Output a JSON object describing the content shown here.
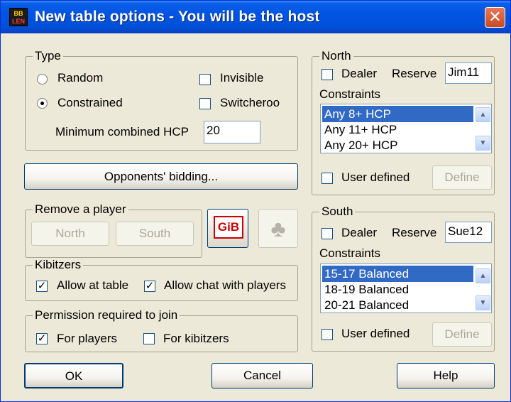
{
  "window": {
    "title": "New table options - You will be the host",
    "icon_text_top": "BB",
    "icon_text_bottom": "LEN"
  },
  "type_group": {
    "legend": "Type",
    "random_label": "Random",
    "constrained_label": "Constrained",
    "selected": "Constrained",
    "invisible_label": "Invisible",
    "invisible_checked": false,
    "switcheroo_label": "Switcheroo",
    "switcheroo_checked": false,
    "min_hcp_label": "Minimum combined HCP",
    "min_hcp_value": "20"
  },
  "opponents_bidding_button": "Opponents' bidding...",
  "remove_player": {
    "legend": "Remove a player",
    "north_button": "North",
    "south_button": "South"
  },
  "gib_button": "GiB",
  "kibitzers": {
    "legend": "Kibitzers",
    "allow_at_table_label": "Allow at table",
    "allow_at_table_checked": true,
    "allow_chat_label": "Allow chat with players",
    "allow_chat_checked": true
  },
  "permission": {
    "legend": "Permission required to join",
    "players_label": "For players",
    "players_checked": true,
    "kibitzers_label": "For kibitzers",
    "kibitzers_checked": false
  },
  "north": {
    "legend": "North",
    "dealer_label": "Dealer",
    "dealer_checked": false,
    "reserve_label": "Reserve",
    "reserve_value": "Jim11",
    "constraints_label": "Constraints",
    "items": [
      "Any 8+ HCP",
      "Any 11+ HCP",
      "Any 20+ HCP"
    ],
    "selected_index": 0,
    "user_defined_label": "User defined",
    "user_defined_checked": false,
    "define_button": "Define"
  },
  "south": {
    "legend": "South",
    "dealer_label": "Dealer",
    "dealer_checked": false,
    "reserve_label": "Reserve",
    "reserve_value": "Sue12",
    "constraints_label": "Constraints",
    "items": [
      "15-17 Balanced",
      "18-19 Balanced",
      "20-21 Balanced"
    ],
    "selected_index": 0,
    "user_defined_label": "User defined",
    "user_defined_checked": false,
    "define_button": "Define"
  },
  "buttons": {
    "ok": "OK",
    "cancel": "Cancel",
    "help": "Help"
  },
  "colors": {
    "titlebar": "#0054e3",
    "selection": "#316ac5",
    "dialog_bg": "#ece9d8"
  }
}
